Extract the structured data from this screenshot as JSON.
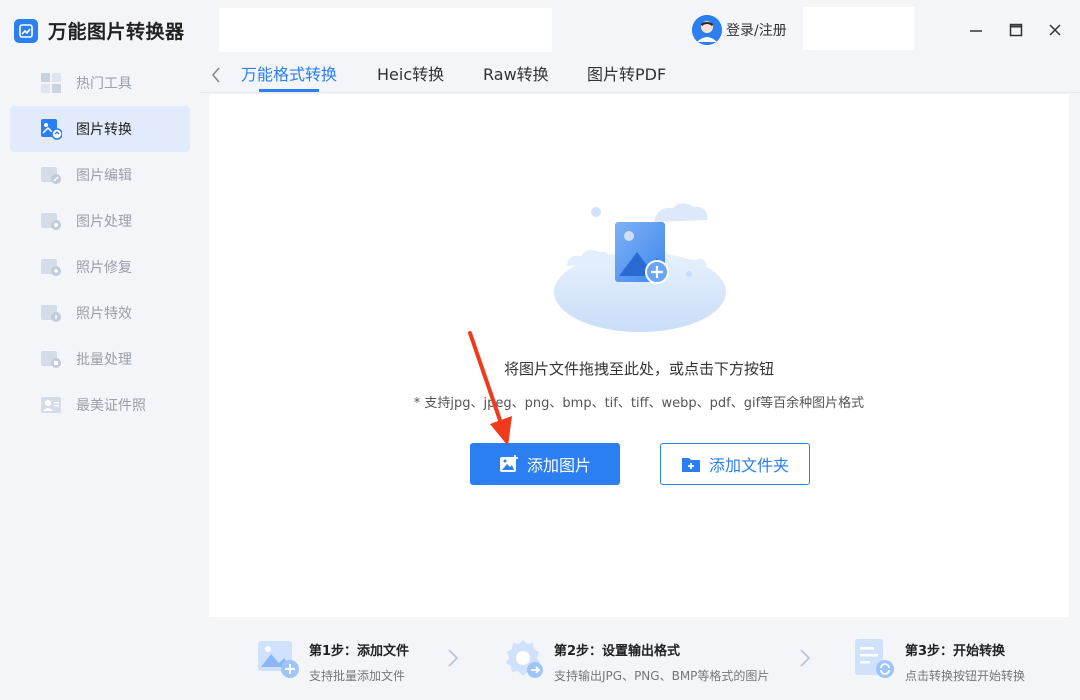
{
  "app": {
    "title": "万能图片转换器"
  },
  "sidebar": {
    "items": [
      {
        "label": "热门工具",
        "icon": "grid-icon",
        "active": false
      },
      {
        "label": "图片转换",
        "icon": "image-convert-icon",
        "active": true
      },
      {
        "label": "图片编辑",
        "icon": "image-edit-icon",
        "active": false
      },
      {
        "label": "图片处理",
        "icon": "image-process-icon",
        "active": false
      },
      {
        "label": "照片修复",
        "icon": "photo-repair-icon",
        "active": false
      },
      {
        "label": "照片特效",
        "icon": "photo-effect-icon",
        "active": false
      },
      {
        "label": "批量处理",
        "icon": "batch-icon",
        "active": false
      },
      {
        "label": "最美证件照",
        "icon": "id-photo-icon",
        "active": false
      }
    ]
  },
  "header": {
    "login_label": "登录/注册"
  },
  "tabs": [
    {
      "label": "万能格式转换",
      "active": true
    },
    {
      "label": "Heic转换",
      "active": false
    },
    {
      "label": "Raw转换",
      "active": false
    },
    {
      "label": "图片转PDF",
      "active": false
    }
  ],
  "dropzone": {
    "hint": "将图片文件拖拽至此处，或点击下方按钮",
    "formats": "* 支持jpg、jpeg、png、bmp、tif、tiff、webp、pdf、gif等百余种图片格式",
    "add_image_label": "添加图片",
    "add_folder_label": "添加文件夹"
  },
  "steps": [
    {
      "title": "第1步：添加文件",
      "desc": "支持批量添加文件",
      "icon": "add-image-icon"
    },
    {
      "title": "第2步：设置输出格式",
      "desc": "支持输出JPG、PNG、BMP等格式的图片",
      "icon": "settings-gear-icon"
    },
    {
      "title": "第3步：开始转换",
      "desc": "点击转换按钮开始转换",
      "icon": "convert-doc-icon"
    }
  ],
  "colors": {
    "accent": "#2b7ff0",
    "active_nav_bg": "#e1ebfb",
    "annotation_arrow": "#f03a1c"
  }
}
